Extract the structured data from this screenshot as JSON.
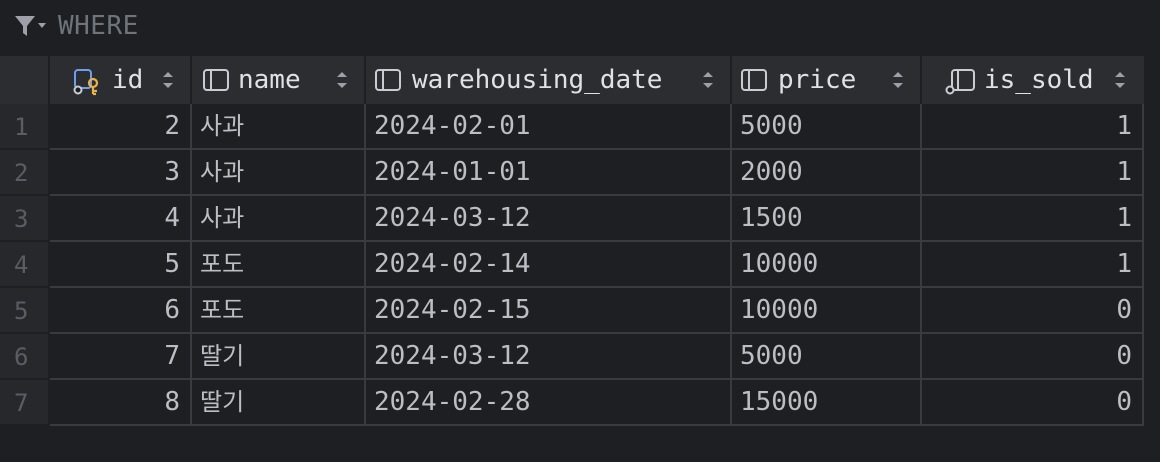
{
  "filter": {
    "label": "WHERE",
    "icon": "filter-icon"
  },
  "columns": [
    {
      "label": "id",
      "icon": "primary-key-column-icon"
    },
    {
      "label": "name",
      "icon": "column-icon"
    },
    {
      "label": "warehousing_date",
      "icon": "column-icon"
    },
    {
      "label": "price",
      "icon": "column-icon"
    },
    {
      "label": "is_sold",
      "icon": "not-null-column-icon"
    }
  ],
  "rows": [
    {
      "num": "1",
      "id": "2",
      "name": "사과",
      "date": "2024-02-01",
      "price": "5000",
      "is_sold": "1"
    },
    {
      "num": "2",
      "id": "3",
      "name": "사과",
      "date": "2024-01-01",
      "price": "2000",
      "is_sold": "1"
    },
    {
      "num": "3",
      "id": "4",
      "name": "사과",
      "date": "2024-03-12",
      "price": "1500",
      "is_sold": "1"
    },
    {
      "num": "4",
      "id": "5",
      "name": "포도",
      "date": "2024-02-14",
      "price": "10000",
      "is_sold": "1"
    },
    {
      "num": "5",
      "id": "6",
      "name": "포도",
      "date": "2024-02-15",
      "price": "10000",
      "is_sold": "0"
    },
    {
      "num": "6",
      "id": "7",
      "name": "딸기",
      "date": "2024-03-12",
      "price": "5000",
      "is_sold": "0"
    },
    {
      "num": "7",
      "id": "8",
      "name": "딸기",
      "date": "2024-02-28",
      "price": "15000",
      "is_sold": "0"
    }
  ],
  "colors": {
    "background": "#1e1f22",
    "header": "#2b2d30",
    "grid_line": "#393b40",
    "key_icon": "#e8b34b",
    "text": "#bcbec4"
  }
}
